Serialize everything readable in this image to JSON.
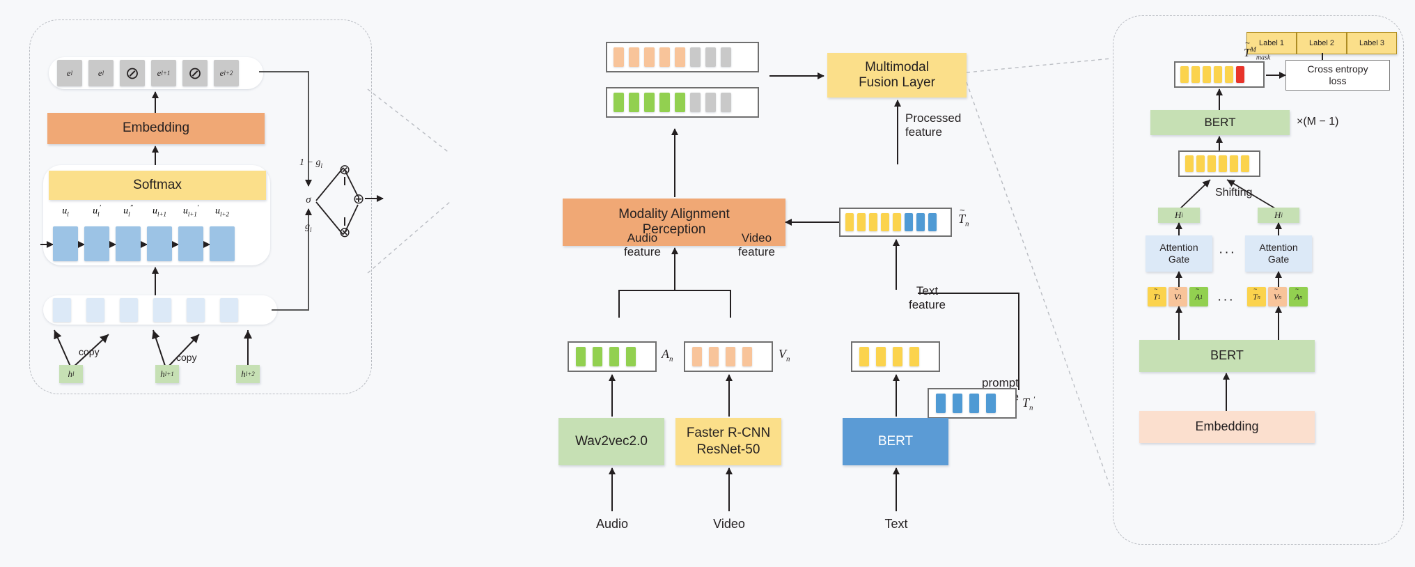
{
  "figure": {
    "title": "Multimodal prompt architecture with modality alignment perception",
    "background": "#f7f8fa"
  },
  "colors": {
    "orange": "#f0a875",
    "yellow": "#fbdf8a",
    "blue": "#5b9bd5",
    "green": "#c6e0b4",
    "peach": "#fbdfce",
    "gray_token": "#c9c9c9",
    "light_blue_token": "#dce9f7",
    "red_token": "#e8342a",
    "orange_token": "#f8c49a",
    "green_token": "#92d050",
    "yellow_token": "#fbd34d",
    "blue_token": "#4f9ad4",
    "stroke": "#231f20",
    "dashed": "#b9bcc2"
  },
  "left_panel": {
    "name": "prompt-generation-detail",
    "embedding_output": {
      "label": "embedding-token-row",
      "tokens": [
        {
          "text": "e_l",
          "kind": "gray"
        },
        {
          "text": "e_l",
          "kind": "gray"
        },
        {
          "text": "⊘",
          "kind": "gray"
        },
        {
          "text": "e_l+1",
          "kind": "gray"
        },
        {
          "text": "⊘",
          "kind": "gray"
        },
        {
          "text": "e_l+2",
          "kind": "gray"
        }
      ],
      "token_labels": [
        "e",
        "e",
        "",
        "e",
        "",
        "e"
      ],
      "token_subs": [
        "l",
        "l",
        "",
        "l+1",
        "",
        "l+2"
      ]
    },
    "embedding_box": "Embedding",
    "softmax_box": "Softmax",
    "u_labels": [
      "u",
      "u",
      "u",
      "u",
      "u",
      "u"
    ],
    "u_subs": [
      "l",
      "l",
      "l",
      "l+1",
      "l+1",
      "l+2"
    ],
    "u_primes": [
      "",
      "′",
      "″",
      "",
      "′",
      ""
    ],
    "hidden_state_count": 6,
    "faded_token_count": 6,
    "copy_labels": [
      "copy",
      "copy"
    ],
    "h_labels": [
      "h",
      "h",
      "h"
    ],
    "h_subs": [
      "l",
      "l+1",
      "l+2"
    ],
    "gate": {
      "sigma": "σ",
      "one_minus_g": "1 − g",
      "one_minus_g_sub": "l",
      "g": "g",
      "g_sub": "l",
      "multiply": "⊗",
      "add": "⊕"
    }
  },
  "middle_panel": {
    "name": "modality-alignment-flow",
    "output_sequences": [
      {
        "name": "video-aligned-sequence",
        "active_count": 5,
        "inactive_count": 3,
        "active_color": "#f8c49a",
        "inactive_color": "#c9c9c9"
      },
      {
        "name": "audio-aligned-sequence",
        "active_count": 5,
        "inactive_count": 3,
        "active_color": "#92d050",
        "inactive_color": "#c9c9c9"
      }
    ],
    "fusion_layer": "Multimodal\nFusion Layer",
    "fusion_layer_line1": "Multimodal",
    "fusion_layer_line2": "Fusion Layer",
    "alignment_block_line1": "Modality Alignment",
    "alignment_block_line2": "Perception",
    "processed_feature_line1": "Processed",
    "processed_feature_line2": "feature",
    "processed_sequence": {
      "name": "processed-feature-sequence",
      "yellow_count": 5,
      "blue_count": 3,
      "symbol": "T",
      "symbol_sub": "n",
      "symbol_accent": "~"
    },
    "audio_feature_line1": "Audio",
    "audio_feature_line2": "feature",
    "video_feature_line1": "Video",
    "video_feature_line2": "feature",
    "text_feature_line1": "Text",
    "text_feature_line2": "feature",
    "prompt_feature_line1": "prompt",
    "prompt_feature_line2": "feature",
    "audio_symbol": "A",
    "audio_symbol_sub": "n",
    "video_symbol": "V",
    "video_symbol_sub": "n",
    "prompt_symbol": "T",
    "prompt_symbol_sub": "n",
    "prompt_symbol_prime": "′",
    "audio_token_count": 4,
    "video_token_count": 4,
    "text_token_count": 4,
    "prompt_token_count": 4,
    "encoders": [
      {
        "name": "audio-encoder",
        "label": "Wav2vec2.0",
        "color": "green",
        "input": "Audio"
      },
      {
        "name": "video-encoder",
        "label": "Faster R-CNN\nResNet-50",
        "line1": "Faster R-CNN",
        "line2": "ResNet-50",
        "color": "yellow",
        "input": "Video"
      },
      {
        "name": "text-encoder",
        "label": "BERT",
        "color": "blue",
        "input": "Text"
      }
    ],
    "inputs": [
      "Audio",
      "Video",
      "Text"
    ]
  },
  "right_panel": {
    "name": "prompt-learning-detail",
    "labels_header": [
      "Label 1",
      "Label 2",
      "Label 3"
    ],
    "masked_symbol": "T",
    "masked_symbol_accent": "~",
    "masked_symbol_sup": "M",
    "masked_symbol_sub": "mask",
    "cross_entropy_line1": "Cross entropy",
    "cross_entropy_line2": "loss",
    "bert_top": "BERT",
    "repeat_label": "×(M − 1)",
    "shifting_label": "Shifting",
    "bert_bottom": "BERT",
    "embedding_bottom": "Embedding",
    "attention_gate_line1": "Attention",
    "attention_gate_line2": "Gate",
    "ellipsis": "···",
    "h_left": "H",
    "h_left_sub": "i",
    "h_right": "H",
    "h_right_sub": "i",
    "mask_row": {
      "yellow_count": 5,
      "red_count": 1
    },
    "mid_row": {
      "yellow_count": 6
    },
    "left_triplet": [
      {
        "symbol": "T",
        "sub": "1",
        "color": "#fbd34d",
        "accent": "~"
      },
      {
        "symbol": "V",
        "sub": "1",
        "color": "#f8c49a",
        "accent": "~"
      },
      {
        "symbol": "A",
        "sub": "1",
        "color": "#92d050",
        "accent": "~"
      }
    ],
    "right_triplet": [
      {
        "symbol": "T",
        "sub": "n",
        "color": "#fbd34d",
        "accent": "~"
      },
      {
        "symbol": "V",
        "sub": "n",
        "color": "#f8c49a",
        "accent": "~"
      },
      {
        "symbol": "A",
        "sub": "n",
        "color": "#92d050",
        "accent": "~"
      }
    ]
  }
}
